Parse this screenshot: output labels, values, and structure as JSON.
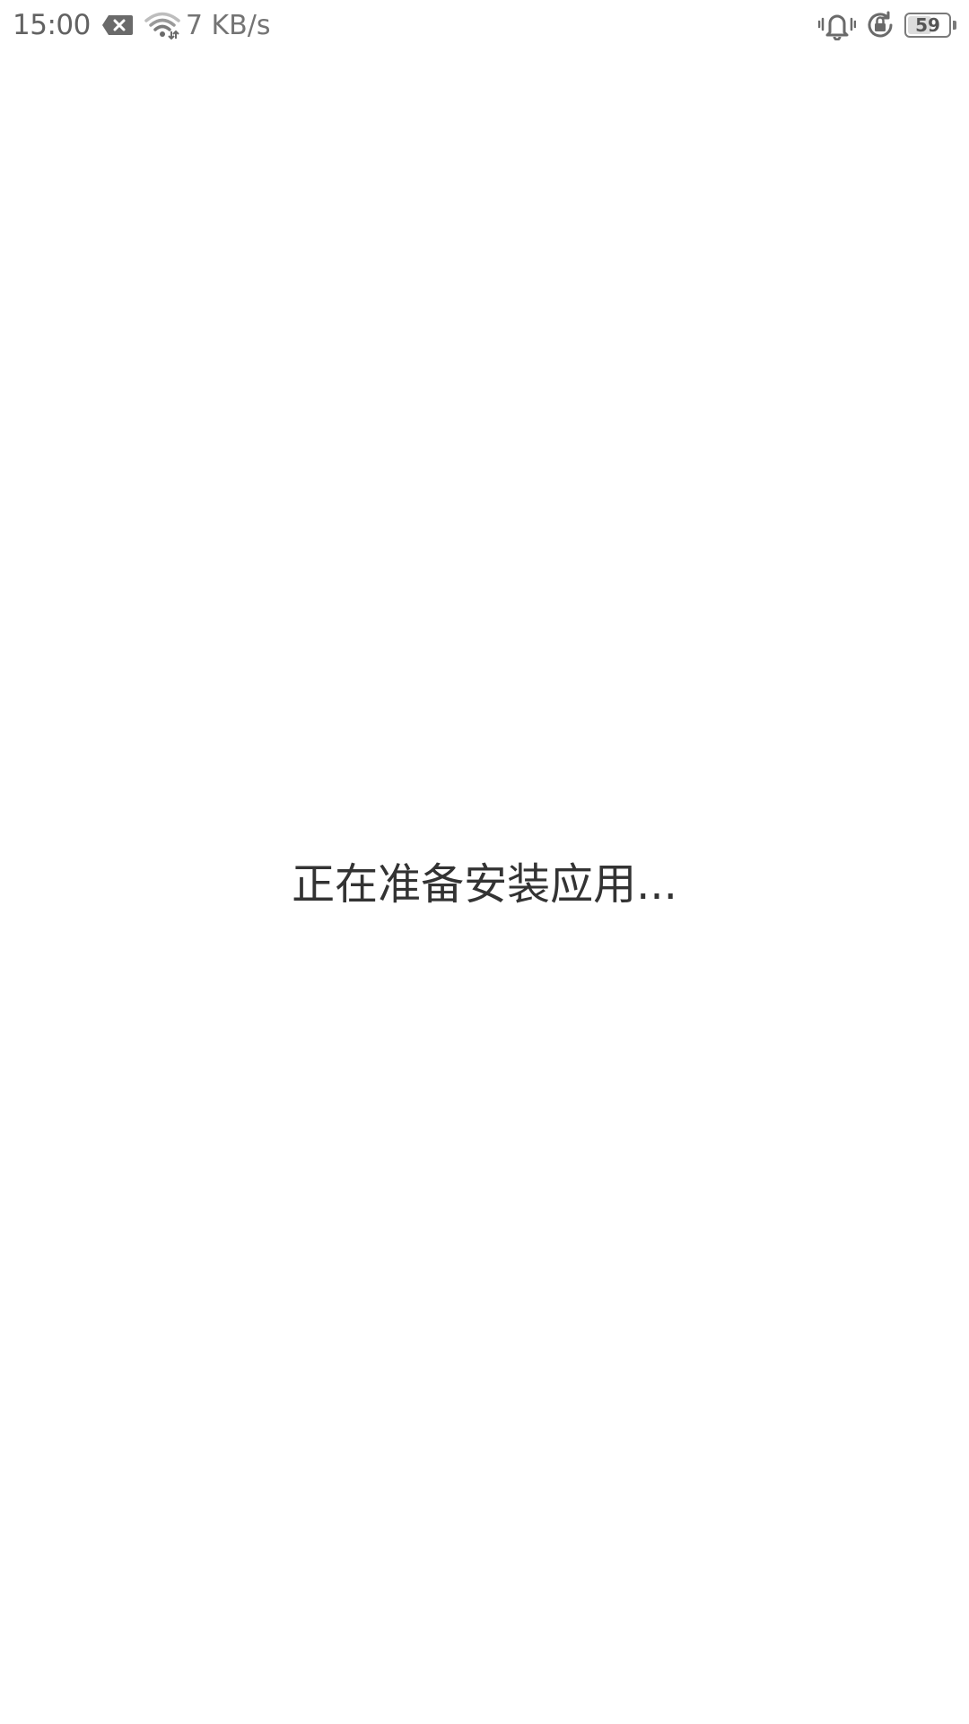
{
  "status_bar": {
    "time": "15:00",
    "network_speed": "7 KB/s",
    "battery_level": "59",
    "battery_percent": 59,
    "icons": [
      "sim-error-icon",
      "wifi-icon",
      "vibrate-icon",
      "rotation-lock-icon",
      "battery-icon"
    ]
  },
  "content": {
    "message": "正在准备安装应用..."
  }
}
